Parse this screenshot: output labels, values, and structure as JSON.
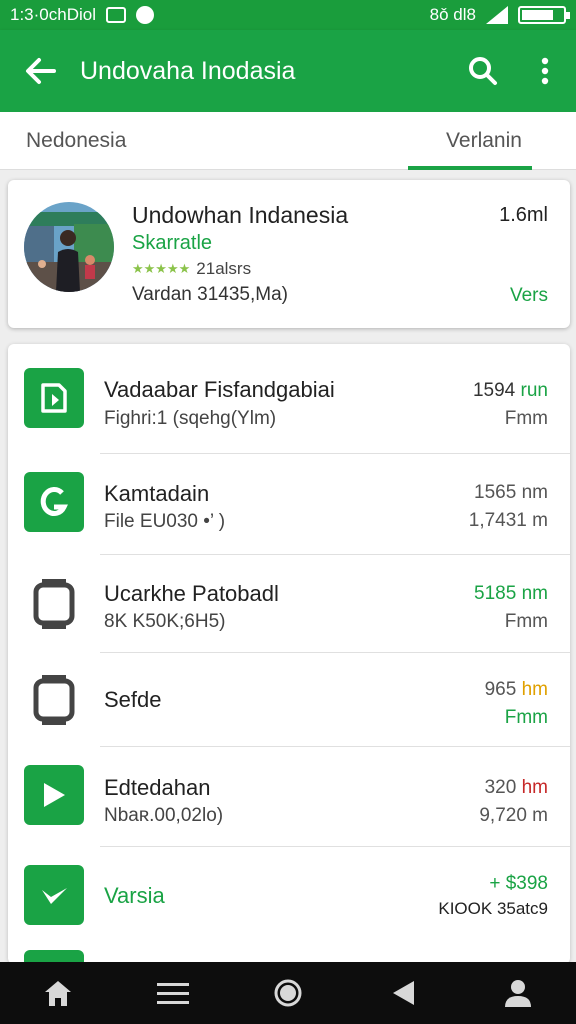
{
  "status_bar": {
    "time_text": "1:3·0chDiol",
    "net_text": "8ǒ dl8",
    "battery_level": 0.8
  },
  "app_bar": {
    "title": "Undovaha Inodasia",
    "back_icon": "arrow-left-icon",
    "search_icon": "search-icon",
    "more_icon": "more-vert-icon"
  },
  "tabs": [
    {
      "label": "Nedonesia",
      "selected": false
    },
    {
      "label": "Verlanin",
      "selected": true
    }
  ],
  "featured": {
    "title": "Undowhan Indanesia",
    "subtitle": "Skarratle",
    "rating_stars": 5,
    "rating_text": "21alsrs",
    "meta": "Vardan 31435,Ma)",
    "size": "1.6ml",
    "action": "Vers"
  },
  "items": [
    {
      "icon": "file-tag-icon",
      "icon_style": "green",
      "title": "Vadaabar Fisfandgabiai",
      "subtitle": "Fighri:1 (sqehg(Ylm)",
      "value1": "1594 run",
      "value1_color": "#333333",
      "value1_suffix_color": "#1aa345",
      "value2": "Fmm",
      "value2_color": "#555555"
    },
    {
      "icon": "google-g-icon",
      "icon_style": "green",
      "title": "Kamtadain",
      "subtitle": "File EU030  •’ )",
      "value1": "1565 nm",
      "value1_color": "#555555",
      "value2": "1,7431 m",
      "value2_color": "#555555"
    },
    {
      "icon": "device-outline-icon",
      "icon_style": "outline",
      "title": "Ucarkhe Patobadl",
      "subtitle": "8K K50K;6H5)",
      "value1": "5185 nm",
      "value1_color": "#1aa345",
      "value2": "Fmm",
      "value2_color": "#555555"
    },
    {
      "icon": "device-outline-icon",
      "icon_style": "outline",
      "title": "Sefde",
      "subtitle": "",
      "value1": "965 hm",
      "value1_color": "#555555",
      "value1_suffix_color": "#e0a000",
      "value2": "Fmm",
      "value2_color": "#1aa345"
    },
    {
      "icon": "play-icon",
      "icon_style": "green",
      "title": "Edtedahan",
      "subtitle": "Nbaʀ.00,02lo)",
      "value1": "320 hm",
      "value1_color": "#555555",
      "value1_suffix_color": "#c62828",
      "value2": "9,720 m",
      "value2_color": "#555555"
    },
    {
      "icon": "check-icon",
      "icon_style": "green",
      "title": "Varsia",
      "title_color": "#1aa345",
      "subtitle": "",
      "value1": "+ $398",
      "value1_color": "#1aa345",
      "value2": "KIOOK 35atc9",
      "value2_color": "#222222"
    }
  ],
  "nav_bar": [
    "home-icon",
    "menu-icon",
    "circle-home-icon",
    "back-triangle-icon",
    "account-icon"
  ]
}
